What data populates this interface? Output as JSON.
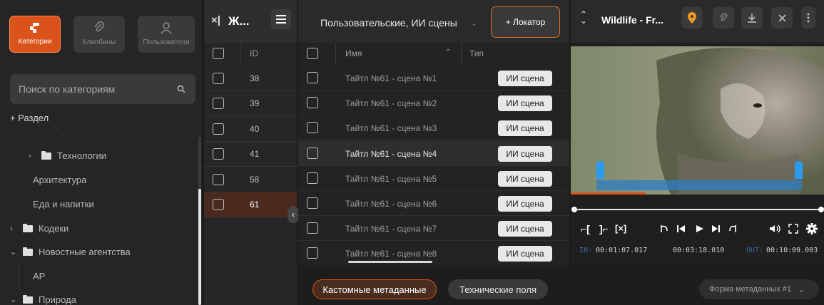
{
  "sidebar": {
    "nav": [
      {
        "label": "Категории",
        "icon": "categories-icon"
      },
      {
        "label": "Клипбины",
        "icon": "paperclip-icon"
      },
      {
        "label": "Пользователи",
        "icon": "user-icon"
      }
    ],
    "search_placeholder": "Поиск по категориям",
    "add_section_label": "+ Раздел",
    "tree": [
      {
        "label": "Технологии"
      },
      {
        "label": "Архитектура"
      },
      {
        "label": "Еда и напитки"
      },
      {
        "label": "Кодеки"
      },
      {
        "label": "Новостные агентства"
      },
      {
        "label": "AP"
      },
      {
        "label": "Природа"
      }
    ]
  },
  "id_panel": {
    "title": "Ж...",
    "close_label": "×|",
    "column_header": "ID",
    "ids": [
      "38",
      "39",
      "40",
      "41",
      "58",
      "61"
    ]
  },
  "list_panel": {
    "dropdown_label": "Пользовательские, ИИ сцены",
    "locator_button": "+ Локатор",
    "col_name": "Имя",
    "col_type": "Тип",
    "rows": [
      {
        "name": "Тайтл №61 - сцена №1",
        "type": "ИИ сцена"
      },
      {
        "name": "Тайтл №61 - сцена №2",
        "type": "ИИ сцена"
      },
      {
        "name": "Тайтл №61 - сцена №3",
        "type": "ИИ сцена"
      },
      {
        "name": "Тайтл №61 - сцена №4",
        "type": "ИИ сцена"
      },
      {
        "name": "Тайтл №61 - сцена №5",
        "type": "ИИ сцена"
      },
      {
        "name": "Тайтл №61 - сцена №6",
        "type": "ИИ сцена"
      },
      {
        "name": "Тайтл №61 - сцена №7",
        "type": "ИИ сцена"
      },
      {
        "name": "Тайтл №61 - сцена №8",
        "type": "ИИ сцена"
      }
    ]
  },
  "bottom_bar": {
    "tab_custom": "Кастомные метаданные",
    "tab_technical": "Технические поля",
    "form_select": "Форма метаданных #1"
  },
  "player": {
    "title": "Wildlife - Fr...",
    "tc_in_label": "IN:",
    "tc_in": "00:01:07.017",
    "tc_duration": "00:03:18.010",
    "tc_out_label": "OUT:",
    "tc_out": "00:10:09.003",
    "mark_in_glyph": "⌐[",
    "mark_out_glyph": "]⌐",
    "clear_marks_glyph": "[×]"
  },
  "colors": {
    "accent": "#d9531a",
    "accent_border": "#ff8a52",
    "marker_blue": "#2b9bf0",
    "timecode_blue": "#4a90d9"
  }
}
